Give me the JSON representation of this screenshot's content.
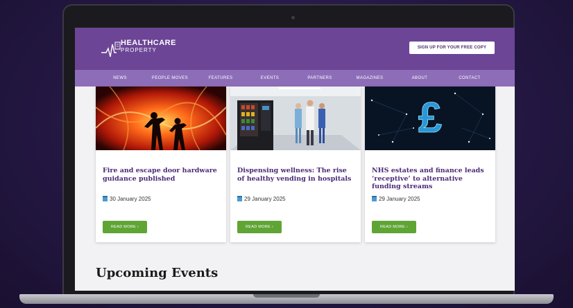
{
  "brand": {
    "name_line1": "HEALTHCARE",
    "name_line2": "PROPERTY",
    "purple": "#6c4596",
    "nav_purple": "#8e6db8",
    "title_color": "#4b2a78",
    "button_green": "#5fa535"
  },
  "header": {
    "signup_label": "SIGN UP FOR YOUR FREE COPY"
  },
  "nav": {
    "items": [
      "NEWS",
      "PEOPLE MOVES",
      "FEATURES",
      "EVENTS",
      "PARTNERS",
      "MAGAZINES",
      "ABOUT",
      "CONTACT"
    ]
  },
  "articles": [
    {
      "title": "Fire and escape door hardware guidance published",
      "date": "30 January 2025",
      "button": "READ MORE",
      "image": "fire-silhouettes-image"
    },
    {
      "title": "Dispensing wellness: The rise of healthy vending in hospitals",
      "date": "29 January 2025",
      "button": "READ MORE",
      "image": "hospital-vending-image"
    },
    {
      "title": "NHS estates and finance leads ‘receptive’ to alternative funding streams",
      "date": "29 January 2025",
      "button": "READ MORE",
      "image": "digital-pound-image"
    }
  ],
  "events": {
    "heading": "Upcoming Events"
  }
}
